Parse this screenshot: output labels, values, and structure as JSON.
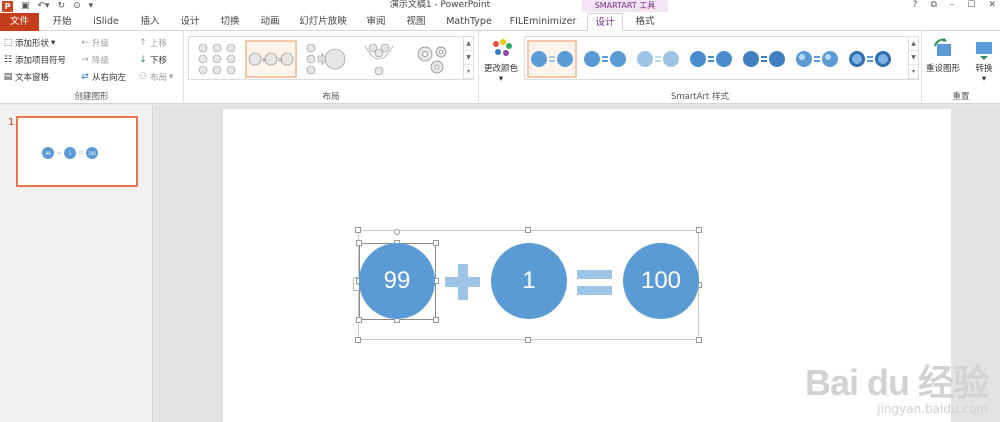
{
  "titlebar": {
    "doc_title": "演示文稿1 - PowerPoint",
    "context_header": "SMARTART 工具",
    "controls": [
      "?",
      "⧉",
      "–",
      "☐",
      "✕"
    ]
  },
  "tabs": [
    "文件",
    "开始",
    "iSlide",
    "插入",
    "设计",
    "切换",
    "动画",
    "幻灯片放映",
    "审阅",
    "视图",
    "MathType",
    "FILEminimizer",
    "设计",
    "格式"
  ],
  "active_tab": "设计",
  "ribbon": {
    "create_group": {
      "label": "创建图形",
      "add_shape": "添加形状",
      "add_bullet": "添加项目符号",
      "text_pane": "文本窗格",
      "promote": "升级",
      "demote": "降级",
      "rtl": "从右向左",
      "move_up": "上移",
      "move_down": "下移",
      "layout": "布局"
    },
    "layout_group": {
      "label": "布局"
    },
    "styles_group": {
      "label": "SmartArt 样式",
      "change_colors": "更改颜色"
    },
    "reset_group": {
      "label": "重置",
      "reset_graphic": "重设图形",
      "convert": "转换"
    }
  },
  "slide_pane": {
    "slide_number": "1"
  },
  "smartart": {
    "values": [
      "99",
      "1",
      "100"
    ],
    "operators": [
      "+",
      "="
    ],
    "circle_color": "#5b9bd5",
    "operator_color": "#9dc3e6"
  },
  "thumbnail": {
    "values": [
      "99",
      "1",
      "100"
    ]
  },
  "watermark": {
    "logo": "Bai du 经验",
    "url": "jingyan.baidu.com"
  }
}
